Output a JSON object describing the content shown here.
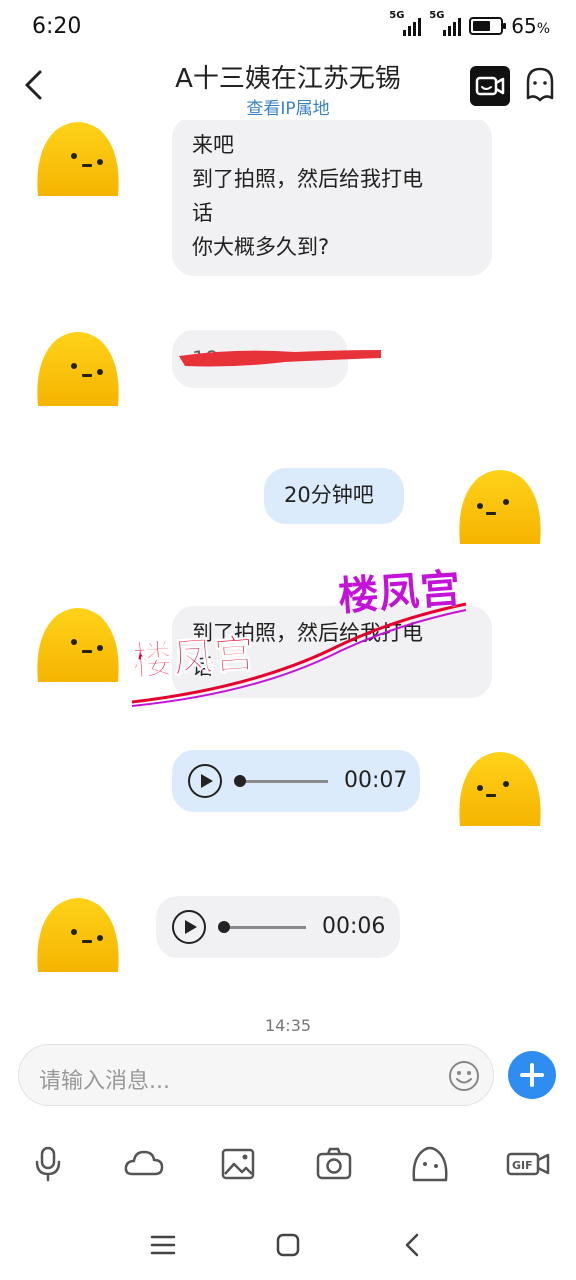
{
  "status_bar": {
    "time": "6:20",
    "sim1": "5G",
    "sim2": "5G",
    "battery_percent": "65",
    "battery_suffix": "%",
    "battery_level": 0.65
  },
  "header": {
    "title": "A十三姨在江苏无锡",
    "subtitle": "查看IP属地",
    "back_icon": "chevron-left-icon",
    "video_icon": "video-call-icon",
    "profile_icon": "profile-icon"
  },
  "messages": [
    {
      "side": "in",
      "lines": [
        "来吧",
        "到了拍照，然后给我打电",
        "话",
        "你大概多久到?"
      ]
    },
    {
      "side": "in",
      "lines": [
        "19"
      ],
      "redacted": true
    },
    {
      "side": "out",
      "lines": [
        "20分钟吧"
      ]
    },
    {
      "side": "in",
      "lines": [
        "到了拍照，然后给我打电",
        "话"
      ]
    },
    {
      "side": "out",
      "type": "voice",
      "duration": "00:07"
    },
    {
      "side": "in",
      "type": "voice",
      "duration": "00:06"
    }
  ],
  "timestamp": "14:35",
  "watermark": {
    "text_red": "楼凤宫",
    "text_purple": "楼凤宫"
  },
  "input": {
    "placeholder": "请输入消息..."
  },
  "toolbar": [
    "mic-icon",
    "cloud-icon",
    "image-icon",
    "camera-icon",
    "sticker-icon",
    "gif-icon"
  ],
  "toolbar_gif_label": "GIF",
  "navbar": [
    "menu-icon",
    "home-icon",
    "back-icon"
  ],
  "colors": {
    "incoming_bubble": "#f1f1f3",
    "outgoing_bubble": "#dcebfb",
    "accent": "#2f8cf0",
    "subtitle": "#3b82c4",
    "avatar": "#f8c20a",
    "watermark_red": "#e6002e",
    "watermark_purple": "#c313d8"
  }
}
